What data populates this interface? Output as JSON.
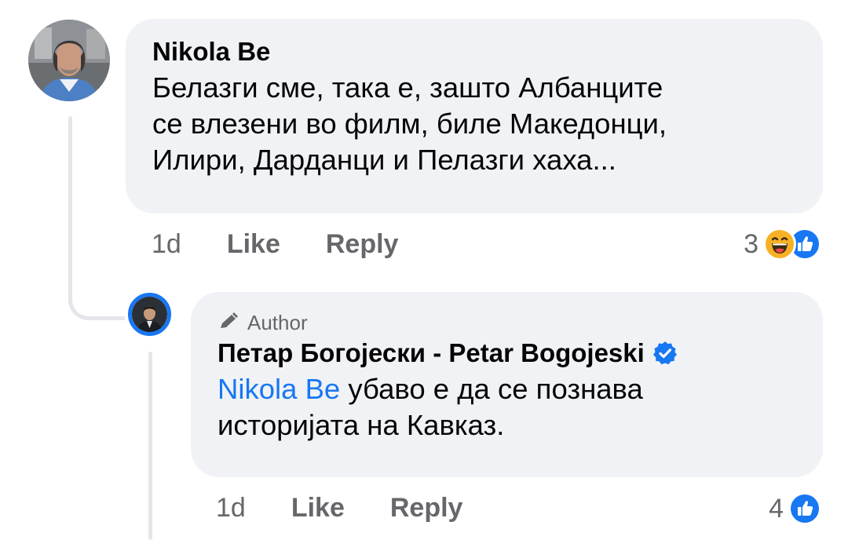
{
  "comment": {
    "author": "Nikola Be",
    "lines": [
      "Белазги сме, така е, зашто Албанците",
      "се влезени во филм, биле Македонци,",
      "Илири, Дарданци и Пелазги хаха..."
    ],
    "time": "1d",
    "like_label": "Like",
    "reply_label": "Reply",
    "reaction_count": "3",
    "reactions": [
      "haha-icon",
      "like-icon"
    ]
  },
  "reply": {
    "badge": "Author",
    "author": "Петар Богојески - Petar Bogojeski",
    "mention": "Nikola Be",
    "line1_rest": " убаво е да се познава",
    "line2": "историјата на Кавказ.",
    "time": "1d",
    "like_label": "Like",
    "reply_label": "Reply",
    "reaction_count": "4",
    "reactions": [
      "like-icon"
    ]
  },
  "colors": {
    "accent": "#1877f2",
    "bubble": "#f0f2f5",
    "secondary_text": "#65676b",
    "haha": "#f7b125"
  }
}
